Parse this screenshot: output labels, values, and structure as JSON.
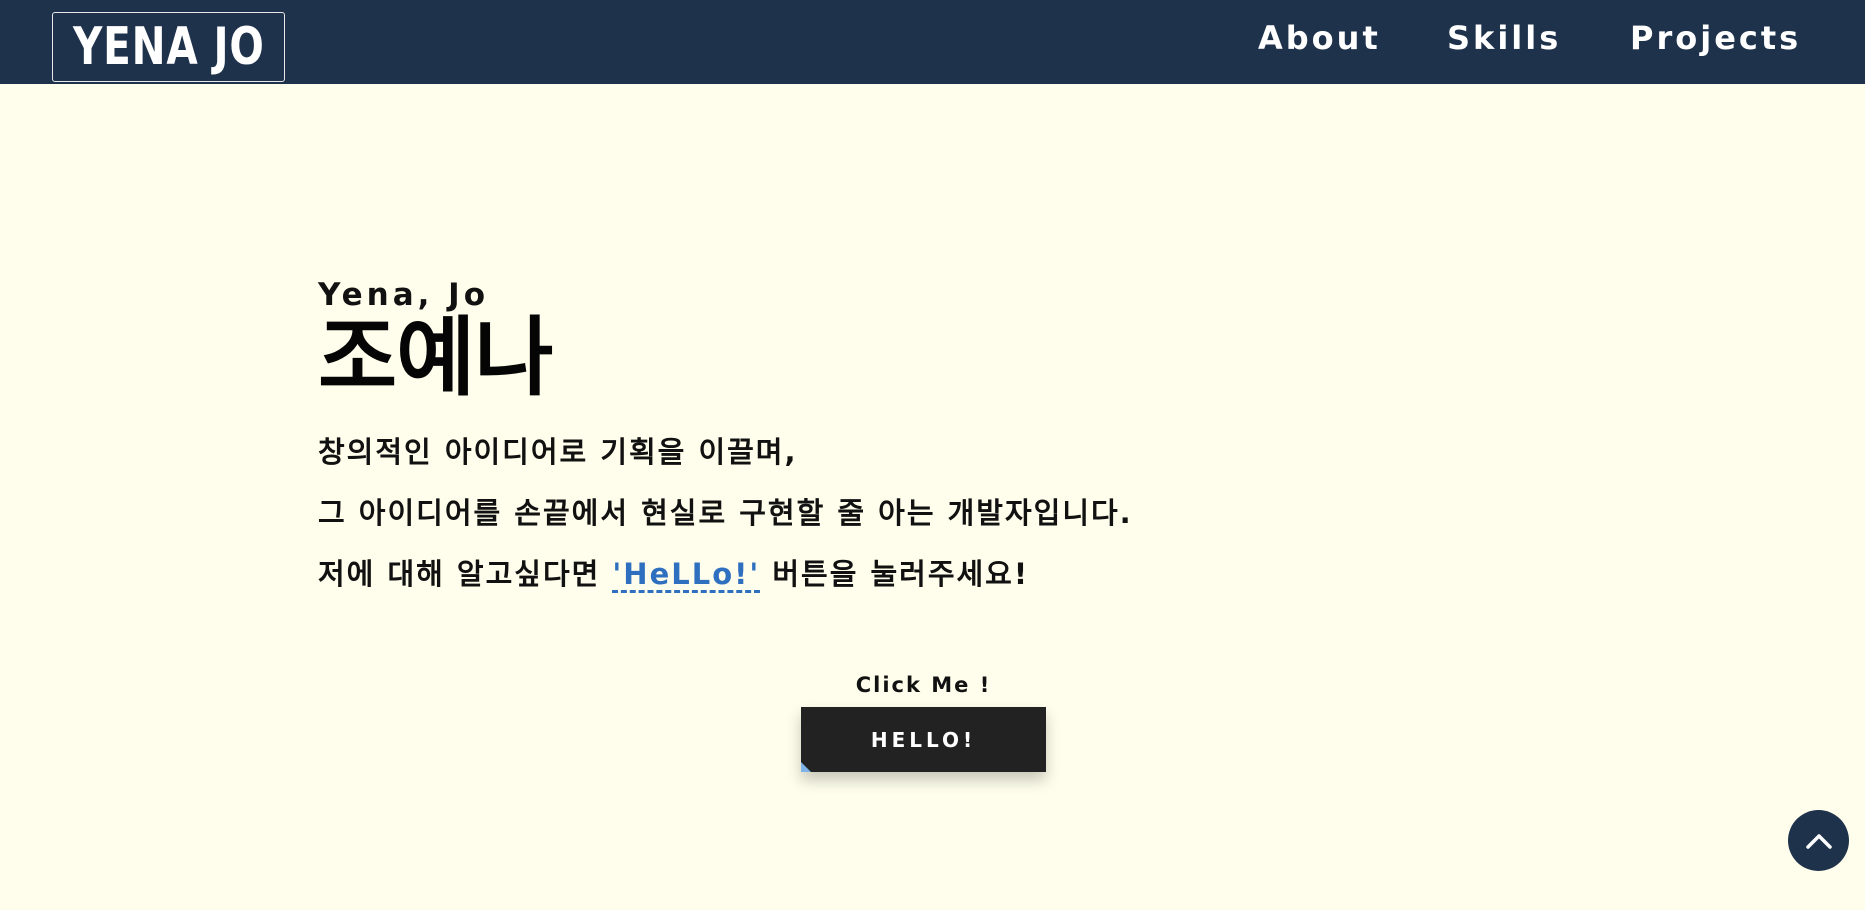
{
  "header": {
    "logo": "YENA JO",
    "nav": [
      {
        "label": "About"
      },
      {
        "label": "Skills"
      },
      {
        "label": "Projects"
      }
    ]
  },
  "intro": {
    "name_en": "Yena, Jo",
    "name_ko": "조예나",
    "line1": "창의적인 아이디어로 기획을 이끌며,",
    "line2": "그 아이디어를 손끝에서 현실로 구현할 줄 아는 개발자입니다.",
    "line3_prefix": "저에 대해 알고싶다면 ",
    "line3_link": "'HeLLo!'",
    "line3_suffix": " 버튼을 눌러주세요!"
  },
  "cta": {
    "label": "Click Me !",
    "button_label": "HELLO!"
  },
  "scroll_top": {
    "icon": "chevron-up-icon"
  },
  "colors": {
    "navbar": "#1f324b",
    "background": "#fffeec",
    "link": "#2e6fc0",
    "button": "#222222"
  }
}
